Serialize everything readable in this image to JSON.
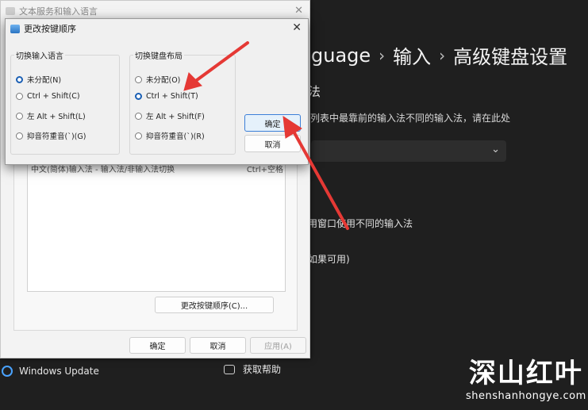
{
  "settings": {
    "breadcrumb": [
      "guage",
      "输入",
      "高级键盘设置"
    ],
    "breadcrumb_sep": "›",
    "section_heading": "法",
    "description": "列表中最靠前的输入法不同的输入法，请在此处",
    "dropdown_chevron": "⌄",
    "option1": "用窗口使用不同的输入法",
    "option2": "如果可用)",
    "windows_update": "Windows Update",
    "get_help": "获取帮助"
  },
  "watermark": {
    "title": "深山红叶",
    "subtitle": "shenshanhongye.com"
  },
  "back_dialog": {
    "title": "文本服务和输入语言",
    "close": "✕",
    "list_row_left": "中文(简体)输入法 - 输入法/非输入法切换",
    "list_row_right": "Ctrl+空格",
    "change_key_button": "更改按键顺序(C)...",
    "ok": "确定",
    "cancel": "取消",
    "apply": "应用(A)"
  },
  "front_dialog": {
    "title": "更改按键顺序",
    "close": "✕",
    "group_input_lang": {
      "title": "切换输入语言",
      "options": [
        "未分配(N)",
        "Ctrl + Shift(C)",
        "左 Alt + Shift(L)",
        "抑音符重音(`)(G)"
      ],
      "selected": 0
    },
    "group_keyboard_layout": {
      "title": "切换键盘布局",
      "options": [
        "未分配(O)",
        "Ctrl + Shift(T)",
        "左 Alt + Shift(F)",
        "抑音符重音(`)(R)"
      ],
      "selected": 1
    },
    "ok": "确定",
    "cancel": "取消"
  },
  "colors": {
    "arrow": "#e53935",
    "selected_radio": "#1a5fb4",
    "accent_button_border": "#3c7fd8"
  }
}
